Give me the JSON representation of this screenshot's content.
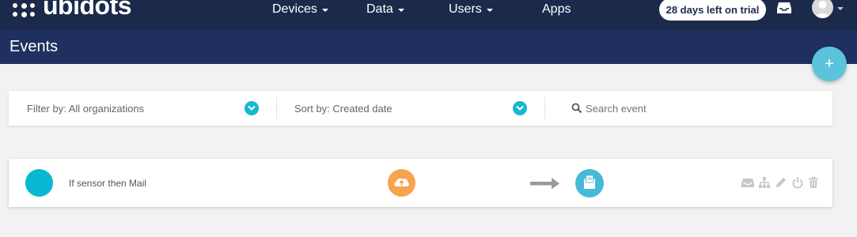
{
  "brand": {
    "name": "ubidots"
  },
  "nav": {
    "items": [
      {
        "label": "Devices",
        "dropdown": true
      },
      {
        "label": "Data",
        "dropdown": true
      },
      {
        "label": "Users",
        "dropdown": true
      },
      {
        "label": "Apps",
        "dropdown": false
      }
    ],
    "trial_badge": "28 days left on trial",
    "icons": [
      "inbox-icon",
      "user-avatar-icon"
    ]
  },
  "page": {
    "title": "Events"
  },
  "add_button": {
    "label": "+"
  },
  "filters": {
    "filter_label": "Filter by: All organizations",
    "sort_label": "Sort by: Created date",
    "search_placeholder": "Search event"
  },
  "events": [
    {
      "name": "If sensor then Mail",
      "trigger_icon": "cloud-upload-icon",
      "action_icon": "mail-icon",
      "actions": [
        "inbox-icon",
        "sitemap-icon",
        "pencil-icon",
        "power-icon",
        "trash-icon"
      ]
    }
  ],
  "colors": {
    "topbar": "#1b2a4a",
    "titlebar": "#1f3060",
    "accent": "#17b7d3",
    "fab": "#5bc4dc",
    "trigger": "#f7a34f",
    "action": "#47b9d6",
    "event_dot": "#08b8d0"
  }
}
